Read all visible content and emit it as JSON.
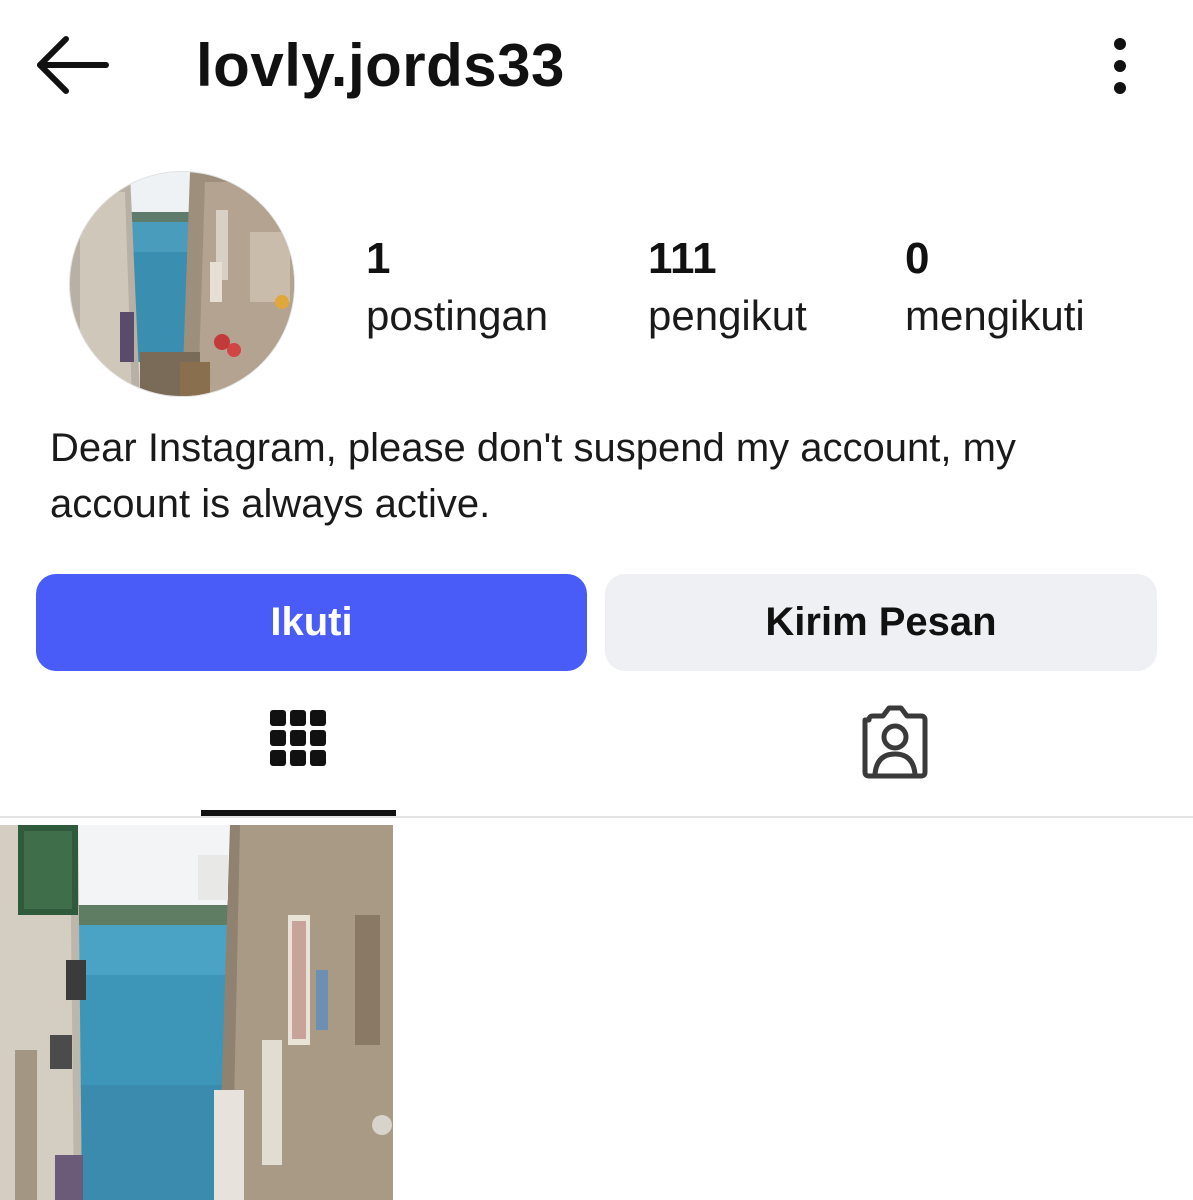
{
  "header": {
    "username": "lovly.jords33",
    "back_icon": "arrow-left-icon",
    "more_icon": "more-vertical-icon"
  },
  "profile": {
    "avatar_alt": "avatar",
    "stats": {
      "posts": {
        "value": "1",
        "label": "postingan"
      },
      "followers": {
        "value": "111",
        "label": "pengikut"
      },
      "following": {
        "value": "0",
        "label": "mengikuti"
      }
    },
    "bio": "Dear Instagram, please don't suspend my account, my account is always active."
  },
  "actions": {
    "follow_label": "Ikuti",
    "message_label": "Kirim Pesan"
  },
  "tabs": [
    {
      "name": "grid",
      "icon": "grid-icon",
      "active": true
    },
    {
      "name": "tagged",
      "icon": "tagged-person-icon",
      "active": false
    }
  ],
  "posts": [
    {
      "thumbnail": "alley-sea-photo"
    }
  ],
  "colors": {
    "accent": "#4a5cf7",
    "secondary_button": "#eff0f3",
    "text": "#111111",
    "divider": "#e4e4e4"
  }
}
